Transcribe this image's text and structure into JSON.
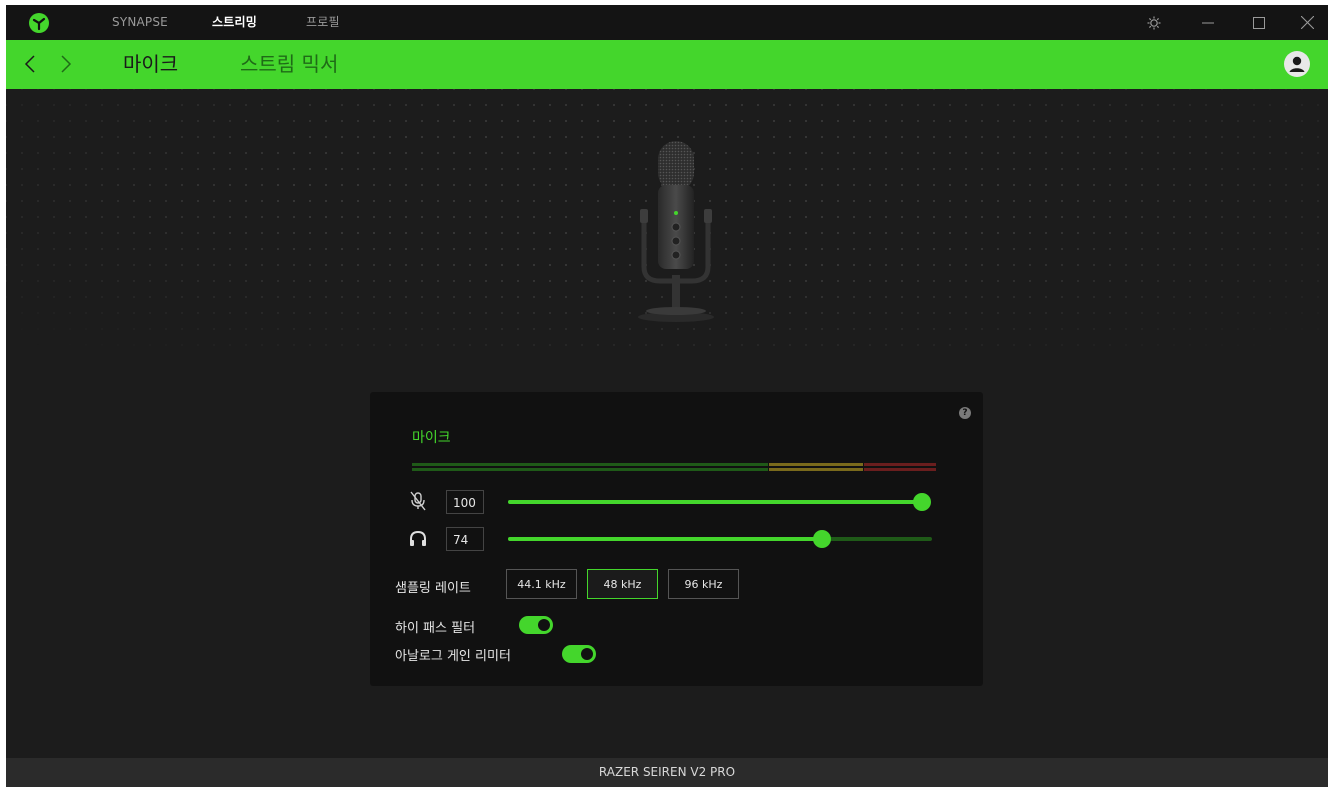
{
  "titlebar": {
    "tabs": [
      {
        "label": "SYNAPSE",
        "active": false
      },
      {
        "label": "스트리밍",
        "active": true
      },
      {
        "label": "프로필",
        "active": false
      }
    ],
    "icons": [
      "razer-logo-icon",
      "settings-gear-icon",
      "minimize-icon",
      "maximize-icon",
      "close-icon"
    ]
  },
  "nav": {
    "tabs": [
      {
        "label": "마이크",
        "active": true
      },
      {
        "label": "스트림 믹서",
        "active": false
      }
    ]
  },
  "panel": {
    "title": "마이크",
    "help_glyph": "?",
    "mic_volume": {
      "value": "100",
      "level": 100,
      "icon": "mic-mute-icon"
    },
    "monitor_volume": {
      "value": "74",
      "level": 74,
      "icon": "headphones-icon"
    },
    "sampling": {
      "label": "샘플링 레이트",
      "options": [
        "44.1 kHz",
        "48 kHz",
        "96 kHz"
      ],
      "selected": "48 kHz"
    },
    "high_pass_filter": {
      "label": "하이 패스 필터",
      "on": true
    },
    "analog_gain_limiter": {
      "label": "아날로그 게인 리미터",
      "on": true
    }
  },
  "footer": {
    "device_name": "RAZER SEIREN V2 PRO"
  },
  "colors": {
    "accent": "#44d62c",
    "background": "#1c1c1c",
    "panel": "#111111"
  }
}
